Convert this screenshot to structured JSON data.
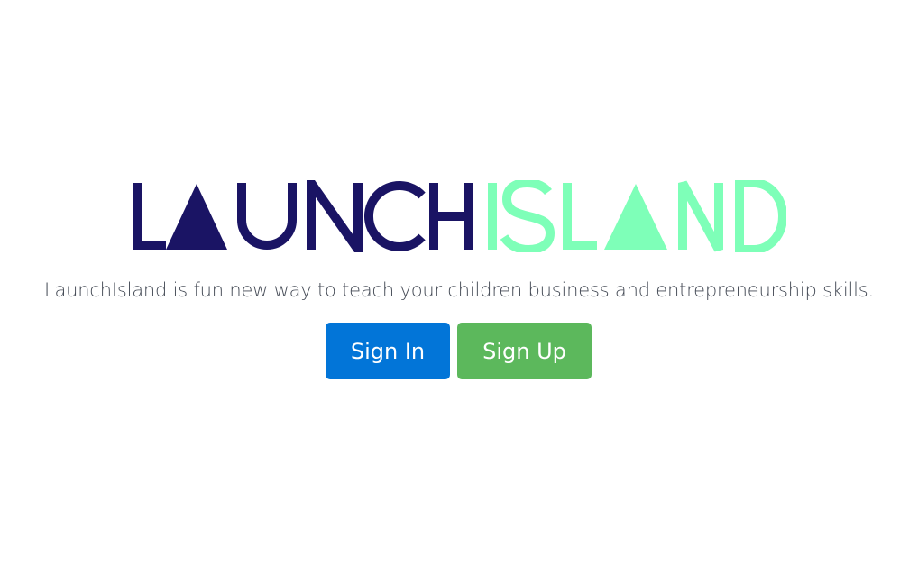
{
  "logo": {
    "word_left": "LAUNCH",
    "word_right": "ISLAND",
    "color_left": "#1a1464",
    "color_right": "#7effb8"
  },
  "tagline": "LaunchIsland is fun new way to teach your children business and entrepreneurship skills.",
  "buttons": {
    "sign_in": {
      "label": "Sign In",
      "color": "#0275d8"
    },
    "sign_up": {
      "label": "Sign Up",
      "color": "#5cb85c"
    }
  }
}
